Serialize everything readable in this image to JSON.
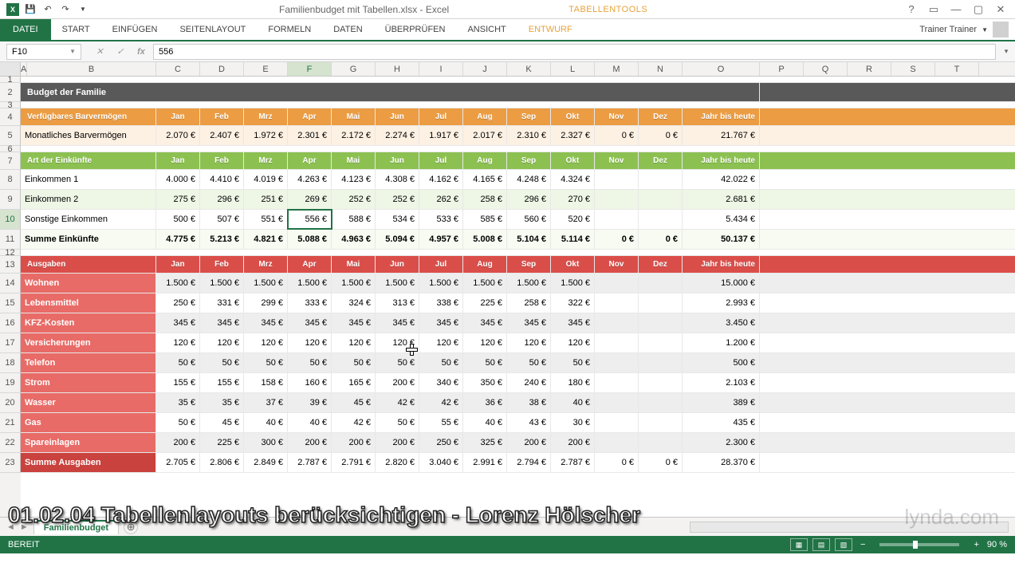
{
  "app": {
    "title": "Familienbudget mit Tabellen.xlsx - Excel",
    "context_tools": "TABELLENTOOLS",
    "user": "Trainer Trainer"
  },
  "ribbon": {
    "file": "DATEI",
    "tabs": [
      "START",
      "EINFÜGEN",
      "SEITENLAYOUT",
      "FORMELN",
      "DATEN",
      "ÜBERPRÜFEN",
      "ANSICHT"
    ],
    "context": "ENTWURF"
  },
  "namebox": "F10",
  "formula": "556",
  "columns": [
    "A",
    "B",
    "C",
    "D",
    "E",
    "F",
    "G",
    "H",
    "I",
    "J",
    "K",
    "L",
    "M",
    "N",
    "O",
    "P",
    "Q",
    "R",
    "S",
    "T"
  ],
  "months": [
    "Jan",
    "Feb",
    "Mrz",
    "Apr",
    "Mai",
    "Jun",
    "Jul",
    "Aug",
    "Sep",
    "Okt",
    "Nov",
    "Dez"
  ],
  "ytd_label": "Jahr bis heute",
  "title_cell": "Budget der Familie",
  "sections": {
    "cash": {
      "header": "Verfügbares Barvermögen",
      "row_label": "Monatliches Barvermögen",
      "values": [
        "2.070 €",
        "2.407 €",
        "1.972 €",
        "2.301 €",
        "2.172 €",
        "2.274 €",
        "1.917 €",
        "2.017 €",
        "2.310 €",
        "2.327 €",
        "0 €",
        "0 €"
      ],
      "ytd": "21.767 €"
    },
    "income": {
      "header": "Art der Einkünfte",
      "rows": [
        {
          "label": "Einkommen 1",
          "values": [
            "4.000 €",
            "4.410 €",
            "4.019 €",
            "4.263 €",
            "4.123 €",
            "4.308 €",
            "4.162 €",
            "4.165 €",
            "4.248 €",
            "4.324 €",
            "",
            ""
          ],
          "ytd": "42.022 €"
        },
        {
          "label": "Einkommen 2",
          "values": [
            "275 €",
            "296 €",
            "251 €",
            "269 €",
            "252 €",
            "252 €",
            "262 €",
            "258 €",
            "296 €",
            "270 €",
            "",
            ""
          ],
          "ytd": "2.681 €"
        },
        {
          "label": "Sonstige Einkommen",
          "values": [
            "500 €",
            "507 €",
            "551 €",
            "556 €",
            "588 €",
            "534 €",
            "533 €",
            "585 €",
            "560 €",
            "520 €",
            "",
            ""
          ],
          "ytd": "5.434 €"
        }
      ],
      "sum": {
        "label": "Summe Einkünfte",
        "values": [
          "4.775 €",
          "5.213 €",
          "4.821 €",
          "5.088 €",
          "4.963 €",
          "5.094 €",
          "4.957 €",
          "5.008 €",
          "5.104 €",
          "5.114 €",
          "0 €",
          "0 €"
        ],
        "ytd": "50.137 €"
      }
    },
    "expenses": {
      "header": "Ausgaben",
      "rows": [
        {
          "label": "Wohnen",
          "values": [
            "1.500 €",
            "1.500 €",
            "1.500 €",
            "1.500 €",
            "1.500 €",
            "1.500 €",
            "1.500 €",
            "1.500 €",
            "1.500 €",
            "1.500 €",
            "",
            ""
          ],
          "ytd": "15.000 €"
        },
        {
          "label": "Lebensmittel",
          "values": [
            "250 €",
            "331 €",
            "299 €",
            "333 €",
            "324 €",
            "313 €",
            "338 €",
            "225 €",
            "258 €",
            "322 €",
            "",
            ""
          ],
          "ytd": "2.993 €"
        },
        {
          "label": "KFZ-Kosten",
          "values": [
            "345 €",
            "345 €",
            "345 €",
            "345 €",
            "345 €",
            "345 €",
            "345 €",
            "345 €",
            "345 €",
            "345 €",
            "",
            ""
          ],
          "ytd": "3.450 €"
        },
        {
          "label": "Versicherungen",
          "values": [
            "120 €",
            "120 €",
            "120 €",
            "120 €",
            "120 €",
            "120 €",
            "120 €",
            "120 €",
            "120 €",
            "120 €",
            "",
            ""
          ],
          "ytd": "1.200 €"
        },
        {
          "label": "Telefon",
          "values": [
            "50 €",
            "50 €",
            "50 €",
            "50 €",
            "50 €",
            "50 €",
            "50 €",
            "50 €",
            "50 €",
            "50 €",
            "",
            ""
          ],
          "ytd": "500 €"
        },
        {
          "label": "Strom",
          "values": [
            "155 €",
            "155 €",
            "158 €",
            "160 €",
            "165 €",
            "200 €",
            "340 €",
            "350 €",
            "240 €",
            "180 €",
            "",
            ""
          ],
          "ytd": "2.103 €"
        },
        {
          "label": "Wasser",
          "values": [
            "35 €",
            "35 €",
            "37 €",
            "39 €",
            "45 €",
            "42 €",
            "42 €",
            "36 €",
            "38 €",
            "40 €",
            "",
            ""
          ],
          "ytd": "389 €"
        },
        {
          "label": "Gas",
          "values": [
            "50 €",
            "45 €",
            "40 €",
            "40 €",
            "42 €",
            "50 €",
            "55 €",
            "40 €",
            "43 €",
            "30 €",
            "",
            ""
          ],
          "ytd": "435 €"
        },
        {
          "label": "Spareinlagen",
          "values": [
            "200 €",
            "225 €",
            "300 €",
            "200 €",
            "200 €",
            "200 €",
            "250 €",
            "325 €",
            "200 €",
            "200 €",
            "",
            ""
          ],
          "ytd": "2.300 €"
        }
      ],
      "sum": {
        "label": "Summe Ausgaben",
        "values": [
          "2.705 €",
          "2.806 €",
          "2.849 €",
          "2.787 €",
          "2.791 €",
          "2.820 €",
          "3.040 €",
          "2.991 €",
          "2.794 €",
          "2.787 €",
          "0 €",
          "0 €"
        ],
        "ytd": "28.370 €"
      }
    }
  },
  "sheet_tabs": {
    "active": "Familienbudget",
    "others": [],
    "add": "+"
  },
  "status": {
    "ready": "BEREIT",
    "zoom": "90 %"
  },
  "caption": "01.02.04 Tabellenlayouts berücksichtigen - Lorenz Hölscher",
  "watermark": "lynda.com"
}
